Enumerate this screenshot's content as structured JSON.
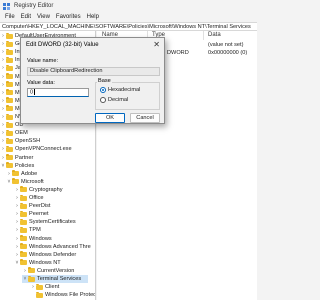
{
  "window": {
    "title": "Registry Editor"
  },
  "menu": [
    "File",
    "Edit",
    "View",
    "Favorites",
    "Help"
  ],
  "address": "Computer\\HKEY_LOCAL_MACHINE\\SOFTWARE\\Policies\\Microsoft\\Windows NT\\Terminal Services",
  "tree": [
    {
      "label": "DefaultUserEnvironment",
      "chevron": "›"
    },
    {
      "label": "Goo",
      "chevron": "›"
    },
    {
      "label": "Inte",
      "chevron": "›"
    },
    {
      "label": "Inte",
      "chevron": "›"
    },
    {
      "label": "JavaSoft",
      "chevron": "›"
    },
    {
      "label": "Mic",
      "chevron": "›"
    },
    {
      "label": "Mic",
      "chevron": "›"
    },
    {
      "label": "Mic",
      "chevron": "›"
    },
    {
      "label": "Mo",
      "chevron": "›"
    },
    {
      "label": "Mo",
      "chevron": "›"
    },
    {
      "label": "NVI",
      "chevron": "›"
    },
    {
      "label": "OD",
      "chevron": "›"
    },
    {
      "label": "OEM",
      "chevron": "›"
    },
    {
      "label": "OpenSSH",
      "chevron": "›"
    },
    {
      "label": "OpenVPNConnect.exe",
      "chevron": "›"
    },
    {
      "label": "Partner",
      "chevron": "›"
    },
    {
      "label": "Policies",
      "chevron": "˅"
    },
    {
      "label": "Adobe",
      "chevron": "›"
    },
    {
      "label": "Microsoft",
      "chevron": "˅"
    },
    {
      "label": "Cryptography",
      "chevron": "›"
    },
    {
      "label": "Office",
      "chevron": "›"
    },
    {
      "label": "PeerDist",
      "chevron": "›"
    },
    {
      "label": "Peernet",
      "chevron": "›"
    },
    {
      "label": "SystemCertificates",
      "chevron": "›"
    },
    {
      "label": "TPM",
      "chevron": "›"
    },
    {
      "label": "Windows",
      "chevron": "›"
    },
    {
      "label": "Windows Advanced Thre",
      "chevron": "›"
    },
    {
      "label": "Windows Defender",
      "chevron": "›"
    },
    {
      "label": "Windows NT",
      "chevron": "˅"
    },
    {
      "label": "CurrentVersion",
      "chevron": "›"
    },
    {
      "label": "Terminal Services",
      "chevron": "˅"
    },
    {
      "label": "Client",
      "chevron": "›"
    },
    {
      "label": "Windows File Protect",
      "chevron": ""
    }
  ],
  "columns": {
    "name": "Name",
    "type": "Type",
    "data": "Data"
  },
  "values": [
    {
      "name": "",
      "type": "",
      "data": "(value not set)"
    },
    {
      "name": "",
      "type": "DWORD",
      "data": "0x00000000 (0)"
    }
  ],
  "dialog": {
    "title": "Edit DWORD (32-bit) Value",
    "close_glyph": "✕",
    "value_name_label": "Value name:",
    "value_name": "Disable ClipboardRedirection",
    "value_data_label": "Value data:",
    "value_data": "0",
    "base_label": "Base",
    "hex_label": "Hexadecimal",
    "dec_label": "Decimal",
    "base_selected": "Hexadecimal",
    "ok_label": "OK",
    "cancel_label": "Cancel"
  }
}
